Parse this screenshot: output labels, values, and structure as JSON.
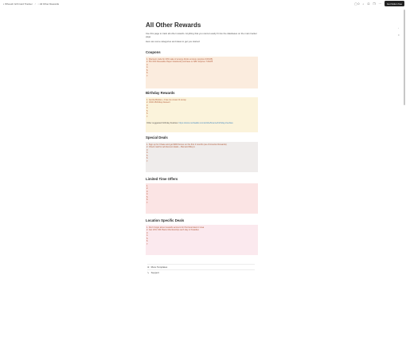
{
  "topbar": {
    "breadcrumb_1": "Whoosh Gift Card Tracker",
    "breadcrumb_2": "All Other Rewards",
    "get_notion": "Get Notion free"
  },
  "page": {
    "title": "All Other Rewards",
    "intro_1": "Use this page to track all other rewards. Anything that you cannot easily fit into the databases on the main tracker page.",
    "intro_2": "Here are some categories and ideas to get you started:"
  },
  "sections": {
    "coupons": {
      "title": "Coupons",
      "items": [
        "1. Discount code for 40% sale of energy drinks at store (expires 3/15/25)",
        "2. 5% OFF Reusable Paper Notebook purchase on $50. Expires 7/16/25",
        "3.",
        "4.",
        "5.",
        "6.",
        "7."
      ]
    },
    "birthday": {
      "title": "Birthday Rewards",
      "items": [
        "1. Jamba Bottles + Free ice cream lit scoop",
        "2. Chili's Birthday Dessert",
        "3.",
        "4.",
        "5.",
        "6.",
        "7."
      ],
      "other_label": "Other suggested birthday freebies: ",
      "other_link": "https://www.nerdwallet.com/article/finance/birthday-freebies"
    },
    "special": {
      "title": "Special Deals",
      "items": [
        "1. Sign up for Chase and get $300 bonus on the first 3 months (as of Amazon Rewards)",
        "2. Check mail for ad discount deals – Bernard Riley's",
        "3.",
        "4.",
        "5.",
        "6.",
        "7."
      ]
    },
    "limited": {
      "title": "Limited Time Offers",
      "items": [
        "1.",
        "2.",
        "3.",
        "4.",
        "5.",
        "6.",
        "7."
      ]
    },
    "location": {
      "title": "Location Specific Deals",
      "items": [
        "1. Don't forget about rewards account for Pat local deal in Iowa",
        "2. Get 10% OFF Barre Membership each day in Paradiso",
        "3.",
        "4.",
        "5.",
        "6.",
        "7."
      ]
    }
  },
  "footer": {
    "more_templates": "More Templates",
    "support": "Support"
  }
}
